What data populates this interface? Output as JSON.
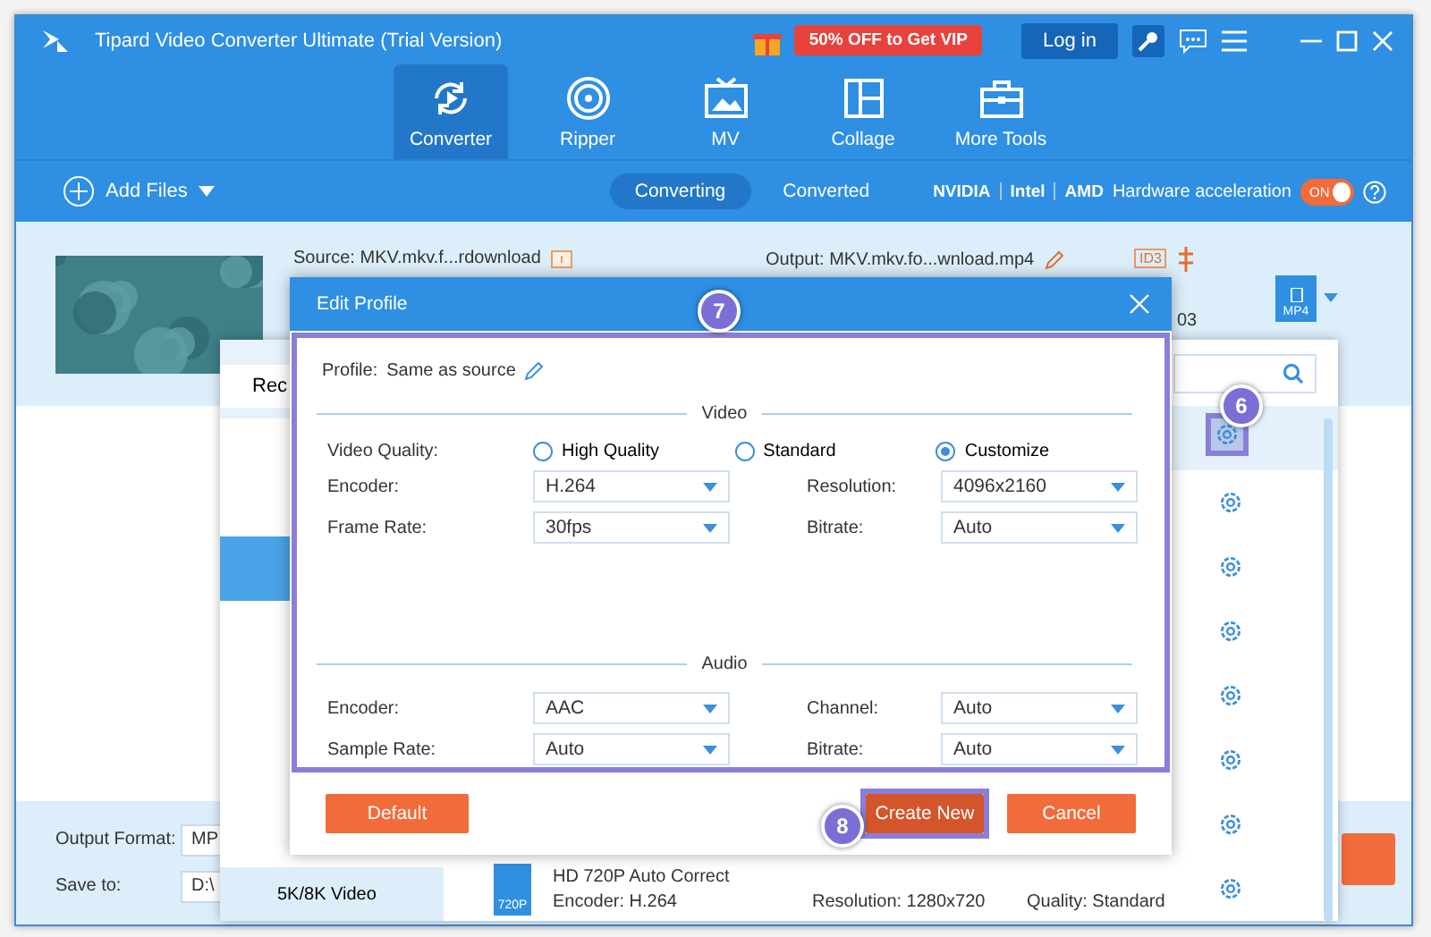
{
  "window": {
    "title": "Tipard Video Converter Ultimate (Trial Version)",
    "promo": "50% OFF to Get VIP",
    "login": "Log in"
  },
  "nav_tabs": [
    {
      "label": "Converter",
      "kind": "converter",
      "selected": true
    },
    {
      "label": "Ripper",
      "kind": "ripper",
      "selected": false
    },
    {
      "label": "MV",
      "kind": "mv",
      "selected": false
    },
    {
      "label": "Collage",
      "kind": "collage",
      "selected": false
    },
    {
      "label": "More Tools",
      "kind": "tools",
      "selected": false
    }
  ],
  "toolbar": {
    "add_files": "Add Files",
    "view_tabs": [
      {
        "label": "Converting",
        "selected": true
      },
      {
        "label": "Converted",
        "selected": false
      }
    ],
    "gpu_brands": [
      "NVIDIA",
      "Intel",
      "AMD"
    ],
    "hw_label": "Hardware acceleration",
    "hw_toggle": {
      "on": true,
      "label": "ON"
    }
  },
  "file": {
    "source": "Source: MKV.mkv.f...rdownload",
    "output": "Output: MKV.mkv.fo...wnload.mp4",
    "tag": "ID3",
    "format_badge": "MP4",
    "partial_text": "03"
  },
  "bottom_bar": {
    "output_format_label": "Output Format:",
    "output_format_value": "MP",
    "save_to_label": "Save to:",
    "save_to_value": "D:\\"
  },
  "format_popup": {
    "tab": "Rec",
    "categories": [
      {
        "selected": true
      },
      {
        "label": "5K/8K Video",
        "selected": false
      }
    ],
    "presets": [
      {
        "selected": true
      },
      {
        "selected": false
      },
      {
        "selected": false
      },
      {
        "selected": false
      },
      {
        "selected": false
      },
      {
        "selected": false
      },
      {
        "selected": false
      },
      {
        "selected": false,
        "badge": "720P",
        "name": "HD 720P Auto Correct",
        "encoder": "Encoder: H.264",
        "resolution": "Resolution: 1280x720",
        "quality": "Quality: Standard"
      }
    ]
  },
  "edit_profile": {
    "title": "Edit Profile",
    "profile_label": "Profile:",
    "profile_value": "Same as source",
    "video": {
      "title": "Video",
      "quality_label": "Video Quality:",
      "quality_options": [
        {
          "label": "High Quality",
          "selected": false
        },
        {
          "label": "Standard",
          "selected": false
        },
        {
          "label": "Customize",
          "selected": true
        }
      ],
      "fields": [
        {
          "label": "Encoder:",
          "value": "H.264"
        },
        {
          "label": "Resolution:",
          "value": "4096x2160"
        },
        {
          "label": "Frame Rate:",
          "value": "30fps"
        },
        {
          "label": "Bitrate:",
          "value": "Auto"
        }
      ]
    },
    "audio": {
      "title": "Audio",
      "fields": [
        {
          "label": "Encoder:",
          "value": "AAC"
        },
        {
          "label": "Channel:",
          "value": "Auto"
        },
        {
          "label": "Sample Rate:",
          "value": "Auto"
        },
        {
          "label": "Bitrate:",
          "value": "Auto"
        }
      ]
    },
    "buttons": [
      {
        "label": "Default",
        "kind": "default"
      },
      {
        "label": "Create New",
        "kind": "create"
      },
      {
        "label": "Cancel",
        "kind": "cancel"
      }
    ]
  },
  "markers": [
    "7",
    "6",
    "8"
  ]
}
